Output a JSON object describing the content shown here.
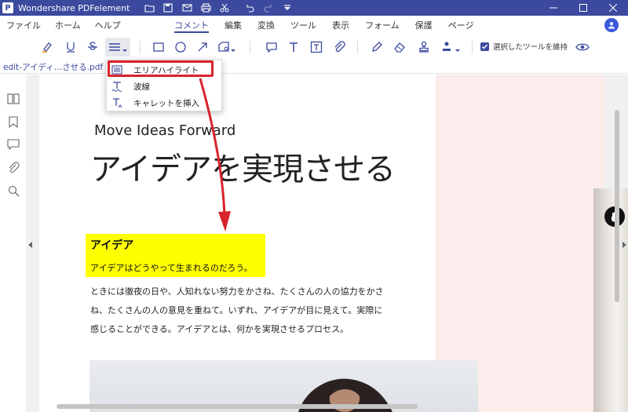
{
  "app": {
    "title": "Wondershare PDFelement",
    "logo_letter": "P"
  },
  "menu": {
    "left_items": [
      "ファイル",
      "ホーム",
      "ヘルプ"
    ],
    "tabs": [
      {
        "label": "コメント",
        "active": true
      },
      {
        "label": "編集",
        "active": false
      },
      {
        "label": "変換",
        "active": false
      },
      {
        "label": "ツール",
        "active": false
      },
      {
        "label": "表示",
        "active": false
      },
      {
        "label": "フォーム",
        "active": false
      },
      {
        "label": "保護",
        "active": false
      },
      {
        "label": "ページ",
        "active": false
      }
    ]
  },
  "toolbar": {
    "keep_tool_label": "選択したツールを維持",
    "keep_tool_checked": true
  },
  "document": {
    "tab_label": "edit-アイディ…させる.pdf *"
  },
  "dropdown": {
    "items": [
      {
        "label": "エリアハイライト",
        "icon": "area-highlight-icon",
        "highlighted": true
      },
      {
        "label": "波線",
        "icon": "squiggly-icon",
        "highlighted": false
      },
      {
        "label": "キャレットを挿入",
        "icon": "caret-insert-icon",
        "highlighted": false
      }
    ]
  },
  "page": {
    "sub_heading": "Move Ideas Forward",
    "main_heading": "アイデアを実現させる",
    "highlight_title": "アイデア",
    "highlight_text": "アイデアはどうやって生まれるのだろう。",
    "body_line1": "ときには徹夜の日や、人知れない努力をかさね、たくさんの人の協力をかさ",
    "body_line2": "ね、たくさんの人の意見を重ねて。いずれ、アイデアが目に見えて。実際に",
    "body_line3": "感じることができる。アイデアとは、何かを実現させるプロセス。"
  },
  "colors": {
    "titlebar": "#3b4a9e",
    "accent": "#3b4a9e",
    "highlight": "#ffff00",
    "annotation_red": "#d9232a",
    "page_side": "#fcecec"
  }
}
